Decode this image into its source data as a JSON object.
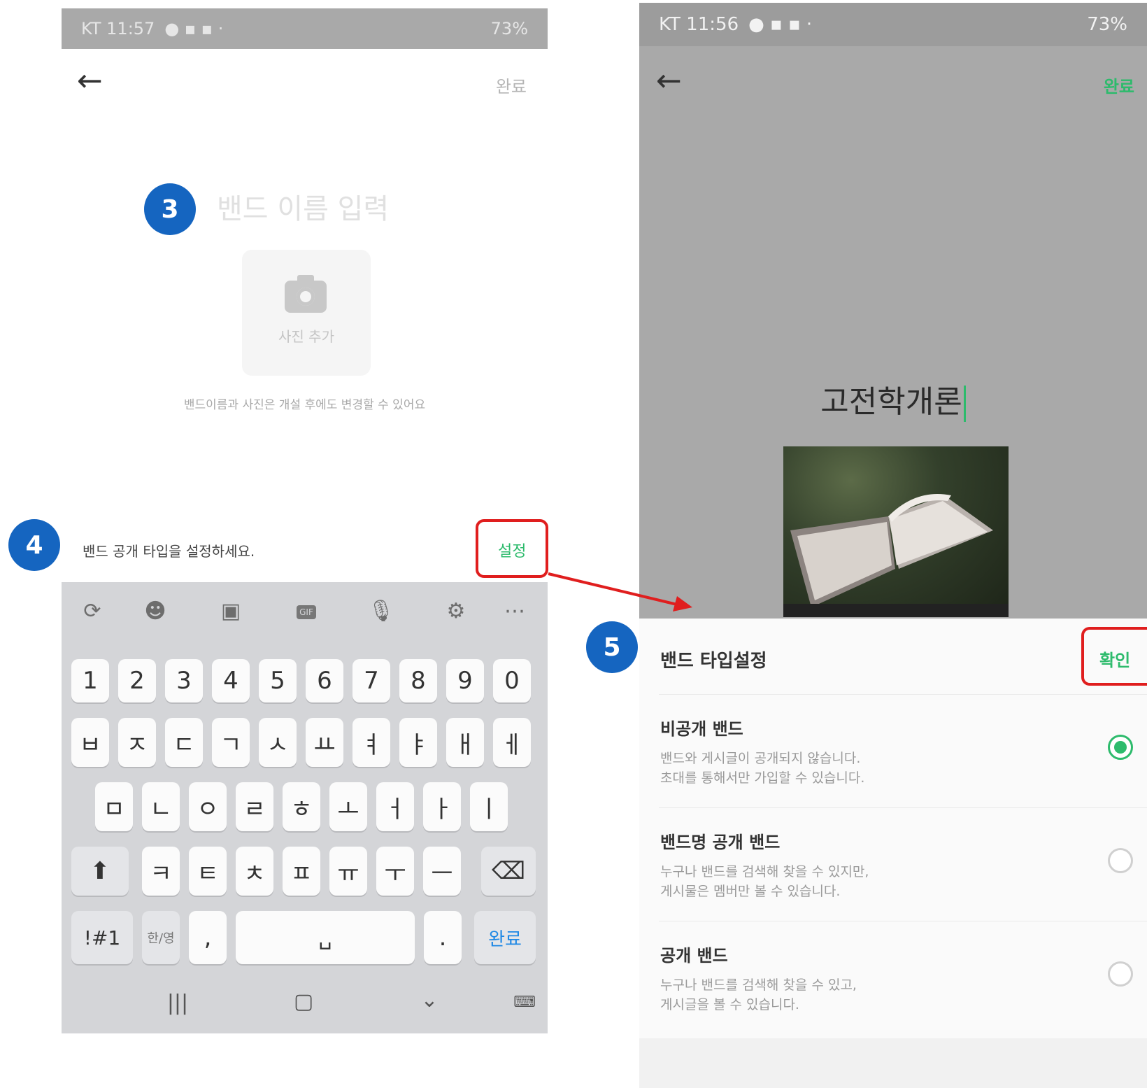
{
  "left": {
    "status": {
      "carrier_time": "KT 11:57",
      "battery": "73%"
    },
    "done_label": "완료",
    "step3": "3",
    "name_placeholder": "밴드 이름 입력",
    "photo_label": "사진 추가",
    "hint": "밴드이름과 사진은 개설 후에도 변경할 수 있어요",
    "step4": "4",
    "public_type_prompt": "밴드 공개 타입을 설정하세요.",
    "set_label": "설정",
    "keyboard": {
      "toolbar_icons": [
        "translate-icon",
        "emoji-icon",
        "sticker-icon",
        "gif-icon",
        "mic-icon",
        "gear-icon",
        "more-icon"
      ],
      "gif": "GIF",
      "row_numbers": [
        "1",
        "2",
        "3",
        "4",
        "5",
        "6",
        "7",
        "8",
        "9",
        "0"
      ],
      "row1": [
        "ㅂ",
        "ㅈ",
        "ㄷ",
        "ㄱ",
        "ㅅ",
        "ㅛ",
        "ㅕ",
        "ㅑ",
        "ㅐ",
        "ㅔ"
      ],
      "row2": [
        "ㅁ",
        "ㄴ",
        "ㅇ",
        "ㄹ",
        "ㅎ",
        "ㅗ",
        "ㅓ",
        "ㅏ",
        "ㅣ"
      ],
      "row3": [
        "ㅋ",
        "ㅌ",
        "ㅊ",
        "ㅍ",
        "ㅠ",
        "ㅜ",
        "ㅡ"
      ],
      "symbols": "!#1",
      "lang": "한/영",
      "comma": ",",
      "period": ".",
      "done": "완료"
    }
  },
  "right": {
    "status": {
      "carrier_time": "KT 11:56",
      "battery": "73%"
    },
    "done_label": "완료",
    "band_name": "고전학개론",
    "step5": "5",
    "sheet_title": "밴드 타입설정",
    "confirm_label": "확인",
    "options": [
      {
        "title": "비공개 밴드",
        "desc1": "밴드와 게시글이 공개되지 않습니다.",
        "desc2": "초대를 통해서만 가입할 수 있습니다.",
        "selected": true
      },
      {
        "title": "밴드명 공개 밴드",
        "desc1": "누구나 밴드를 검색해 찾을 수 있지만,",
        "desc2": "게시물은 멤버만 볼 수 있습니다.",
        "selected": false
      },
      {
        "title": "공개 밴드",
        "desc1": "누구나 밴드를 검색해 찾을 수 있고,",
        "desc2": "게시글을 볼 수 있습니다.",
        "selected": false
      }
    ]
  },
  "colors": {
    "accent_green": "#2dbb6c",
    "badge_blue": "#1565c0",
    "highlight_red": "#e01e1e"
  }
}
